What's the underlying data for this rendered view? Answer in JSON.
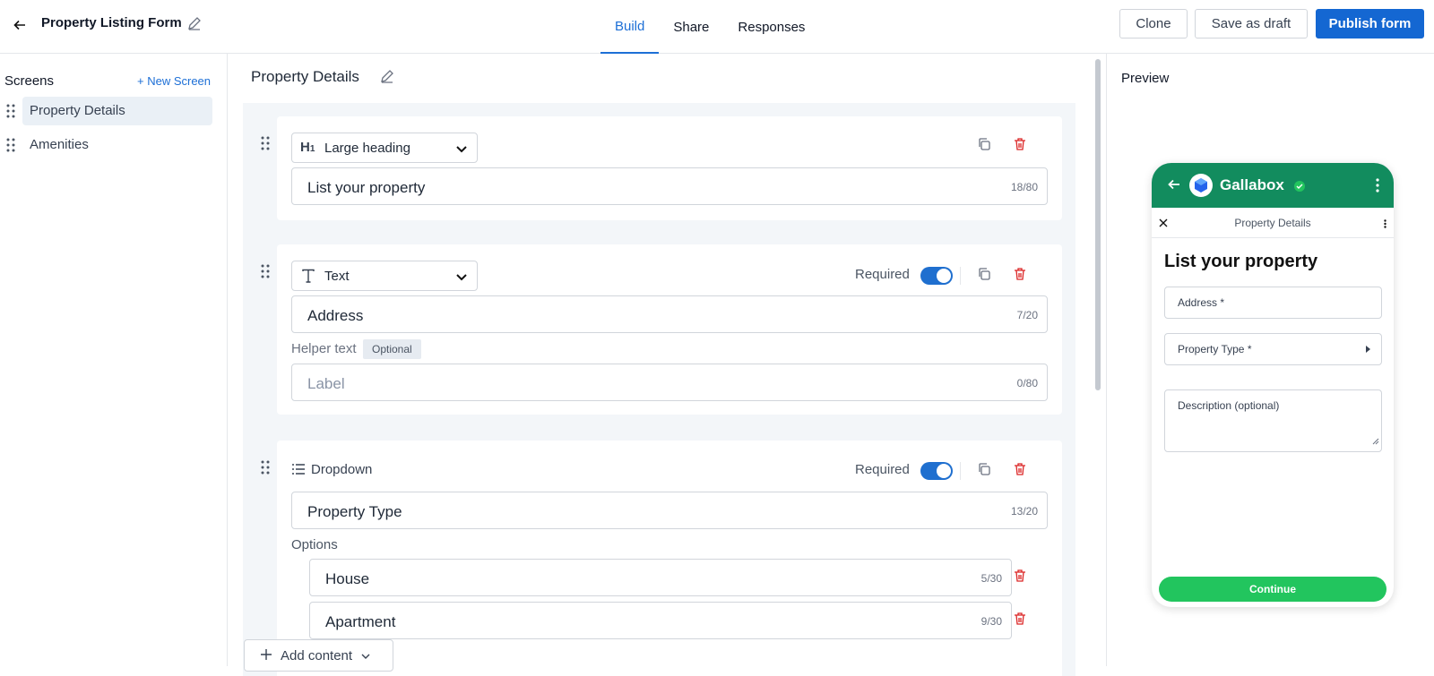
{
  "header": {
    "form_title": "Property Listing Form",
    "tabs": [
      {
        "label": "Build",
        "active": true
      },
      {
        "label": "Share",
        "active": false
      },
      {
        "label": "Responses",
        "active": false
      }
    ],
    "clone_label": "Clone",
    "draft_label": "Save as draft",
    "publish_label": "Publish form"
  },
  "sidebar": {
    "heading": "Screens",
    "new_screen_label": "+ New Screen",
    "items": [
      {
        "label": "Property Details",
        "active": true
      },
      {
        "label": "Amenities",
        "active": false
      }
    ]
  },
  "editor": {
    "screen_title": "Property Details",
    "blocks": [
      {
        "type_label": "Large heading",
        "value": "List your property",
        "counter": "18/80"
      },
      {
        "type_label": "Text",
        "required_label": "Required",
        "required": true,
        "value": "Address",
        "counter": "7/20",
        "helper_label": "Helper text",
        "optional_badge": "Optional",
        "helper_placeholder": "Label",
        "helper_counter": "0/80"
      },
      {
        "type_label": "Dropdown",
        "required_label": "Required",
        "required": true,
        "value": "Property Type",
        "counter": "13/20",
        "options_label": "Options",
        "options": [
          {
            "value": "House",
            "counter": "5/30"
          },
          {
            "value": "Apartment",
            "counter": "9/30"
          }
        ]
      }
    ],
    "add_content_label": "Add content"
  },
  "preview": {
    "heading": "Preview",
    "brand_name": "Gallabox",
    "screen_title": "Property Details",
    "form_heading": "List your property",
    "fields": [
      "Address *",
      "Property Type *"
    ],
    "description_label": "Description (optional)",
    "continue_label": "Continue",
    "colors": {
      "brand": "#128c5e",
      "accent": "#1467d2",
      "continue": "#22c55e",
      "danger": "#dc2626"
    }
  }
}
